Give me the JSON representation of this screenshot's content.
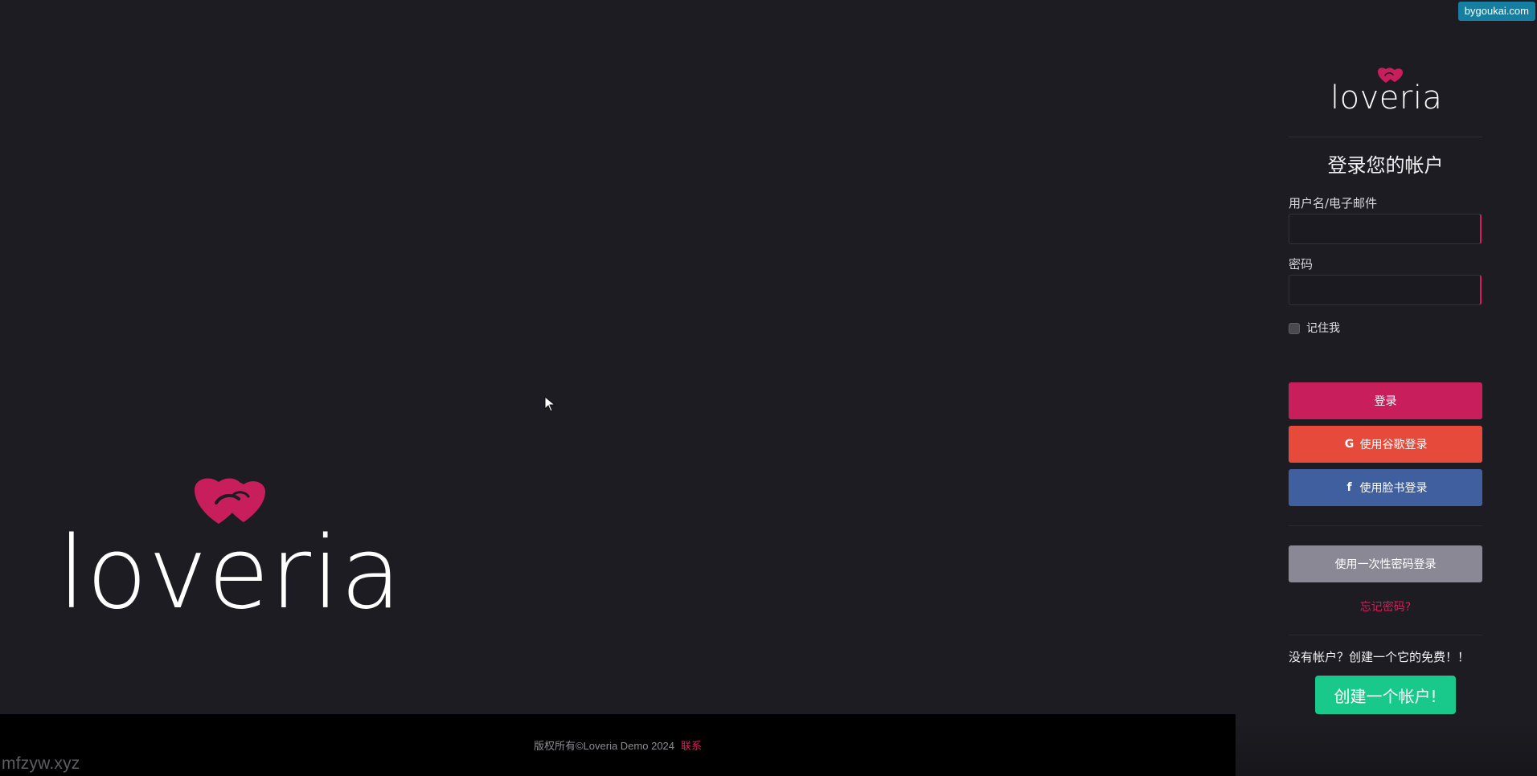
{
  "app": {
    "brand_name": "loveria",
    "watermark": "mfzyw.xyz",
    "badge": "bygoukai.com"
  },
  "footer": {
    "copyright": "版权所有©Loveria Demo 2024",
    "contact": "联系"
  },
  "login": {
    "title": "登录您的帐户",
    "username_label": "用户名/电子邮件",
    "username_value": "",
    "username_placeholder": "",
    "password_label": "密码",
    "password_value": "",
    "password_placeholder": "",
    "remember_label": "记住我",
    "login_button": "登录",
    "google_button": "使用谷歌登录",
    "facebook_button": "使用脸书登录",
    "otp_button": "使用一次性密码登录",
    "forgot_password": "忘记密码?",
    "signup_prompt": "没有帐户？创建一个它的免费！！",
    "create_account_button": "创建一个帐户!"
  },
  "icons": {
    "google": "google-icon",
    "facebook": "facebook-icon",
    "heart": "heart-logo-icon",
    "cursor": "mouse-pointer-icon"
  },
  "colors": {
    "background": "#1d1c22",
    "footer": "#000000",
    "accent": "#c81f5c",
    "google": "#e64a3b",
    "facebook": "#3f5f9f",
    "otp": "#8a8894",
    "create": "#19c88b",
    "badge": "#167ea1"
  }
}
